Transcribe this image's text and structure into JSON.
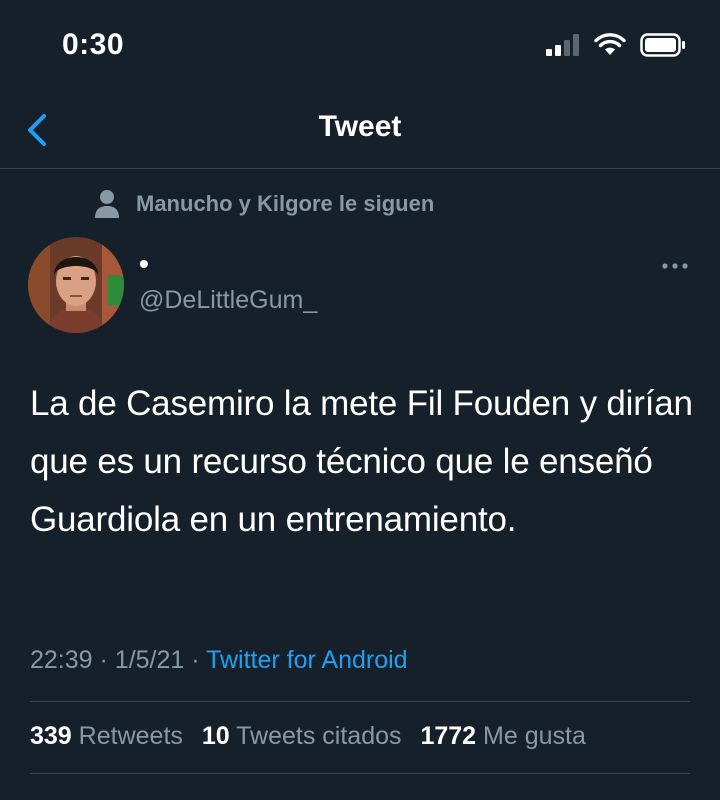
{
  "status": {
    "time": "0:30"
  },
  "nav": {
    "title": "Tweet"
  },
  "social_context": "Manucho y Kilgore le siguen",
  "author": {
    "name": "•",
    "handle": "@DeLittleGum_"
  },
  "tweet": {
    "text": "La de Casemiro la mete Fil Fouden y dirían que es un recurso técnico que le enseñó Guardiola en un entrenamiento.",
    "time": "22:39",
    "date": "1/5/21",
    "source": "Twitter for Android"
  },
  "stats": {
    "retweets": "339",
    "retweets_label": "Retweets",
    "quotes": "10",
    "quotes_label": "Tweets citados",
    "likes": "1772",
    "likes_label": "Me gusta"
  },
  "icons": [
    "signal-icon",
    "wifi-icon",
    "battery-icon",
    "back-chevron-icon",
    "person-icon",
    "avatar",
    "more-icon"
  ],
  "colors": {
    "background": "#15202b",
    "secondary_text": "#8899a6",
    "accent": "#1da1f2",
    "divider": "#38444d"
  }
}
